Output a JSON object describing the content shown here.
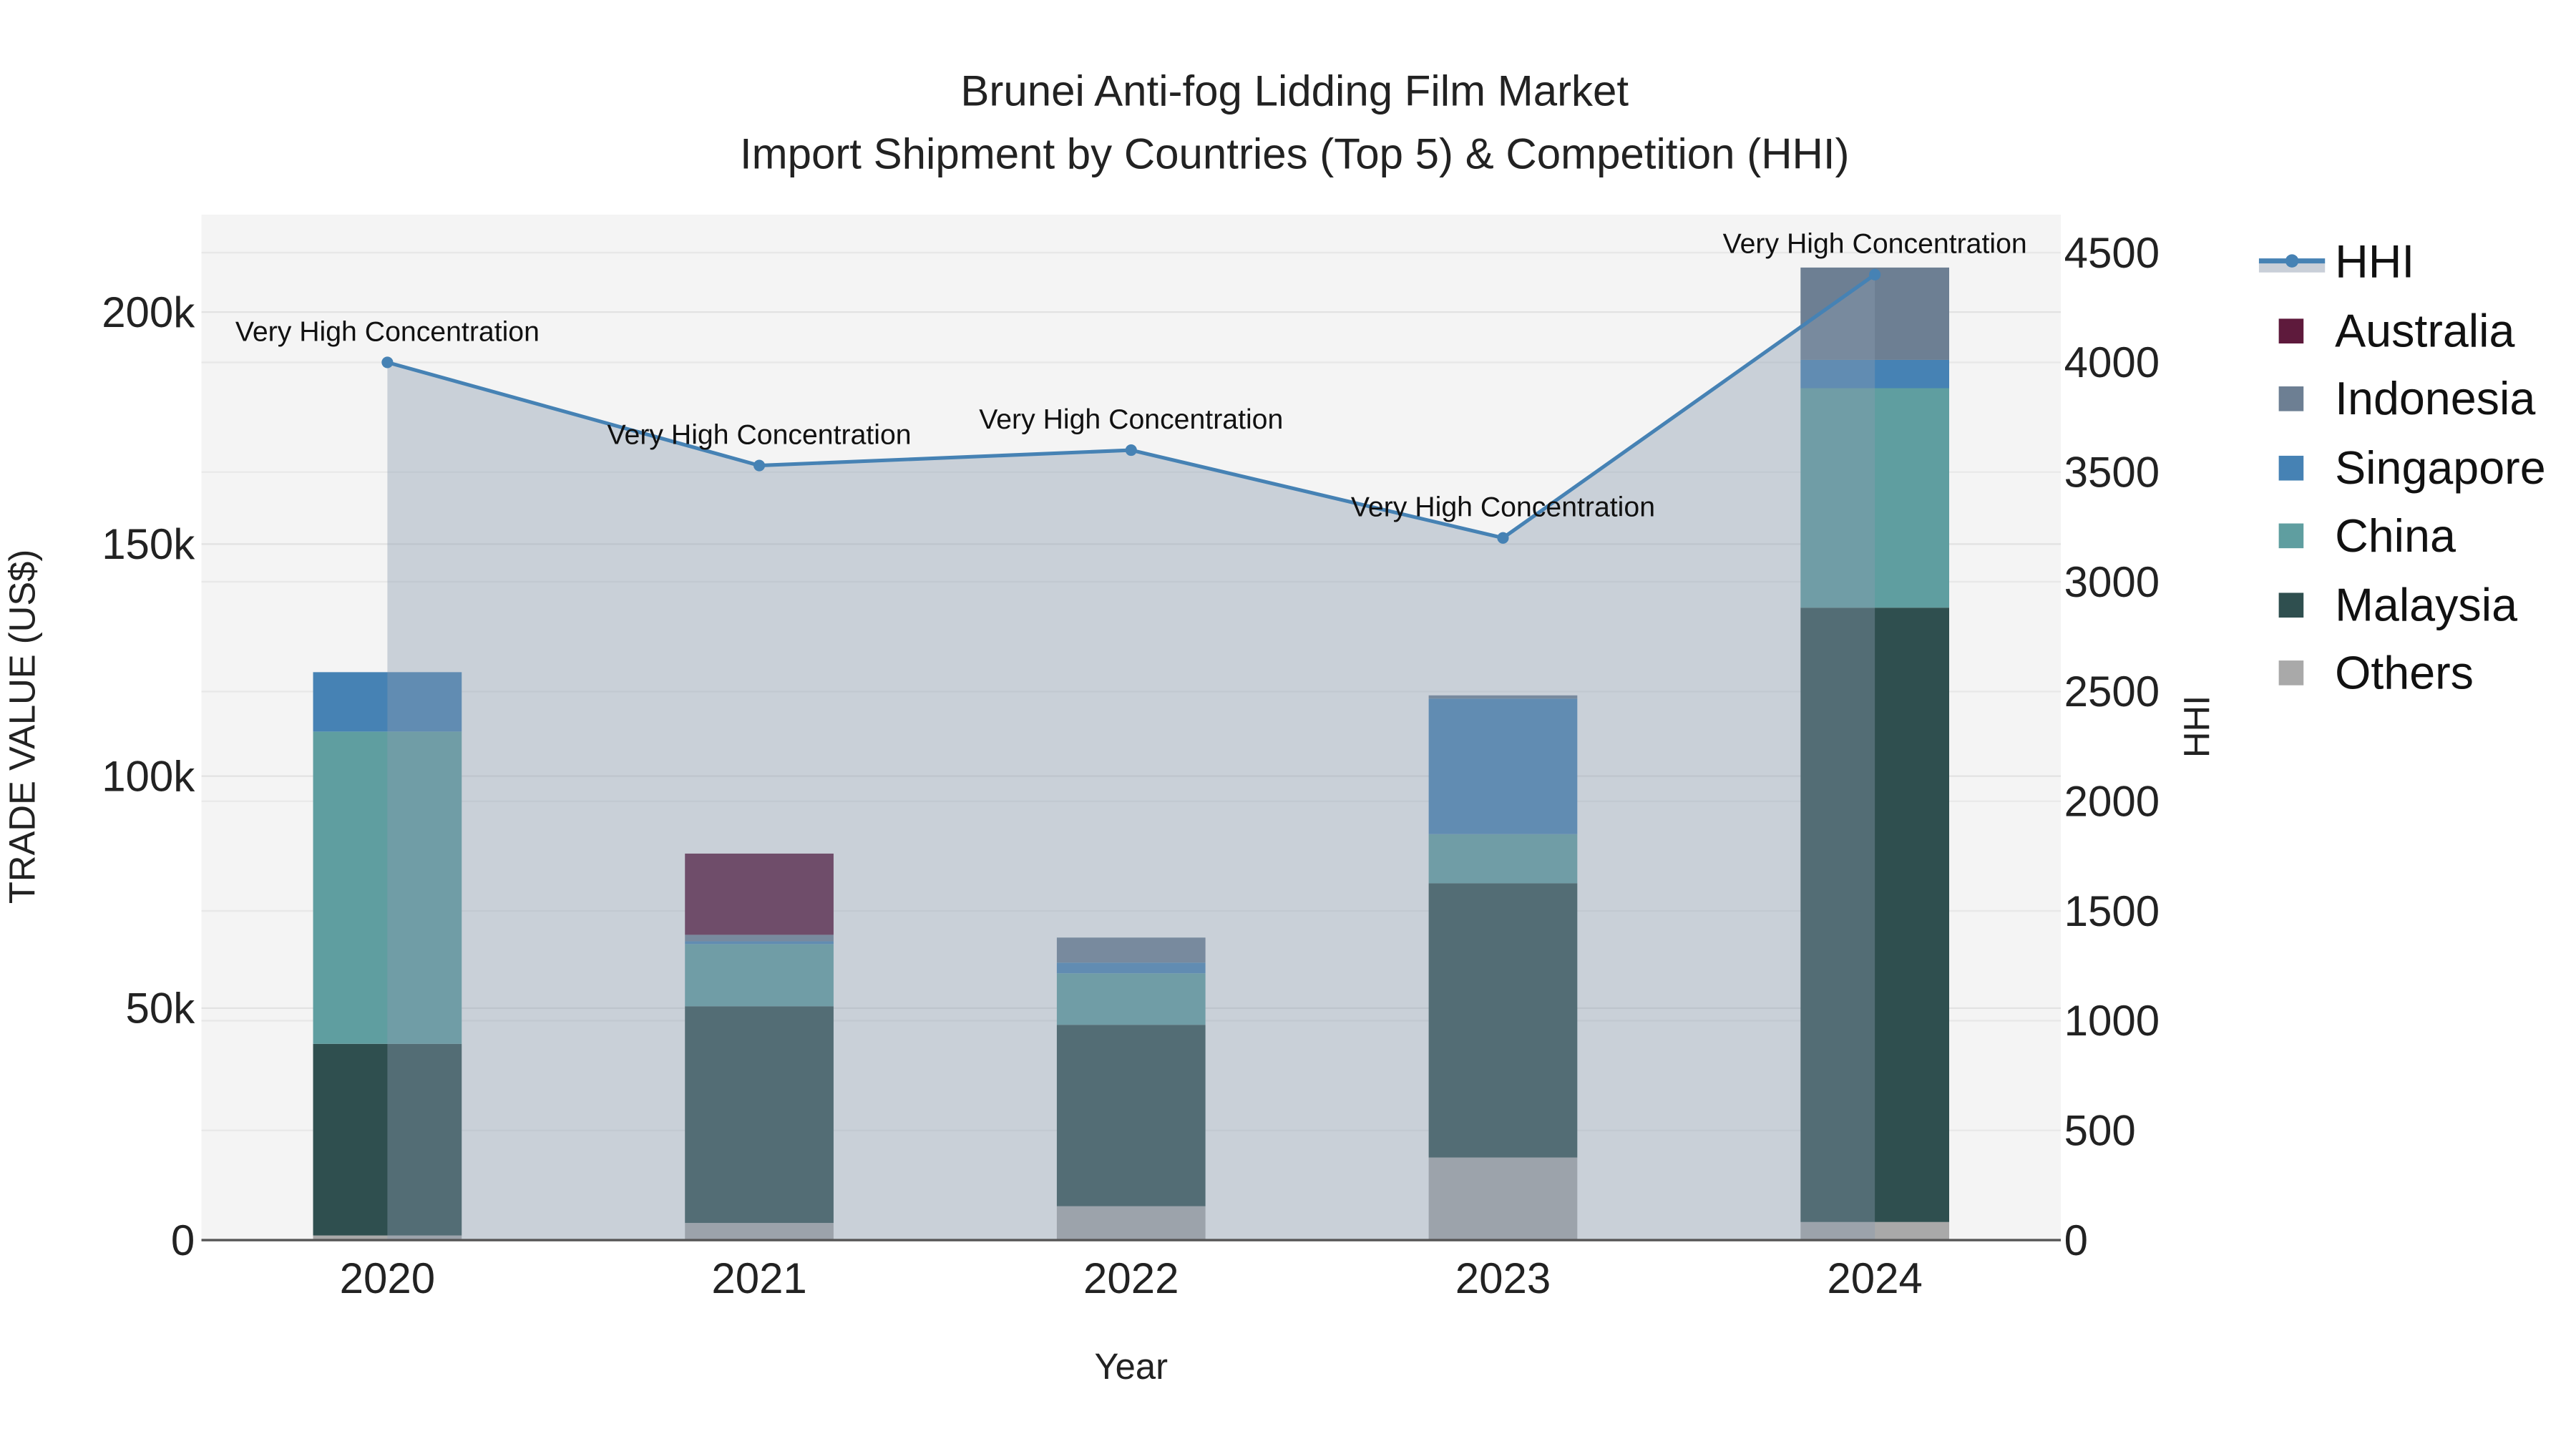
{
  "chart_data": {
    "type": "bar",
    "title": "Brunei Anti-fog Lidding Film Market",
    "subtitle": "Import Shipment by Countries (Top 5) & Competition (HHI)",
    "xlabel": "Year",
    "ylabel": "TRADE VALUE (US$)",
    "y2label": "HHI",
    "categories": [
      "2020",
      "2021",
      "2022",
      "2023",
      "2024"
    ],
    "ylim": [
      0,
      220000
    ],
    "y2lim": [
      0,
      4650
    ],
    "yticks": [
      0,
      50000,
      100000,
      150000,
      200000
    ],
    "ytick_labels": [
      "0",
      "50k",
      "100k",
      "150k",
      "200k"
    ],
    "y2ticks": [
      0,
      500,
      1000,
      1500,
      2000,
      2500,
      3000,
      3500,
      4000,
      4500
    ],
    "y2tick_labels": [
      "0",
      "500",
      "1000",
      "1500",
      "2000",
      "2500",
      "3000",
      "3500",
      "4000",
      "4500"
    ],
    "stacked": true,
    "series": [
      {
        "name": "Others",
        "color": "#a9a9a9",
        "values": [
          1000,
          3700,
          7300,
          17800,
          3900
        ]
      },
      {
        "name": "Malaysia",
        "color": "#2f4f4f",
        "values": [
          41300,
          46700,
          39100,
          59100,
          132400
        ]
      },
      {
        "name": "China",
        "color": "#5f9ea0",
        "values": [
          67300,
          13400,
          11100,
          10600,
          47300
        ]
      },
      {
        "name": "Singapore",
        "color": "#4682b4",
        "values": [
          12800,
          600,
          2300,
          29200,
          6100
        ]
      },
      {
        "name": "Indonesia",
        "color": "#6d7f93",
        "values": [
          0,
          1400,
          5400,
          700,
          19900
        ]
      },
      {
        "name": "Australia",
        "color": "#5e1a3c",
        "values": [
          0,
          17500,
          0,
          0,
          0
        ]
      }
    ],
    "line": {
      "name": "HHI",
      "color": "#4682b4",
      "axis": "right",
      "values": [
        4000,
        3530,
        3600,
        3200,
        4400
      ],
      "annotations": [
        "Very High Concentration",
        "Very High Concentration",
        "Very High Concentration",
        "Very High Concentration",
        "Very High Concentration"
      ]
    },
    "legend_order": [
      "HHI",
      "Australia",
      "Indonesia",
      "Singapore",
      "China",
      "Malaysia",
      "Others"
    ],
    "legend_position": "right",
    "grid": true
  }
}
